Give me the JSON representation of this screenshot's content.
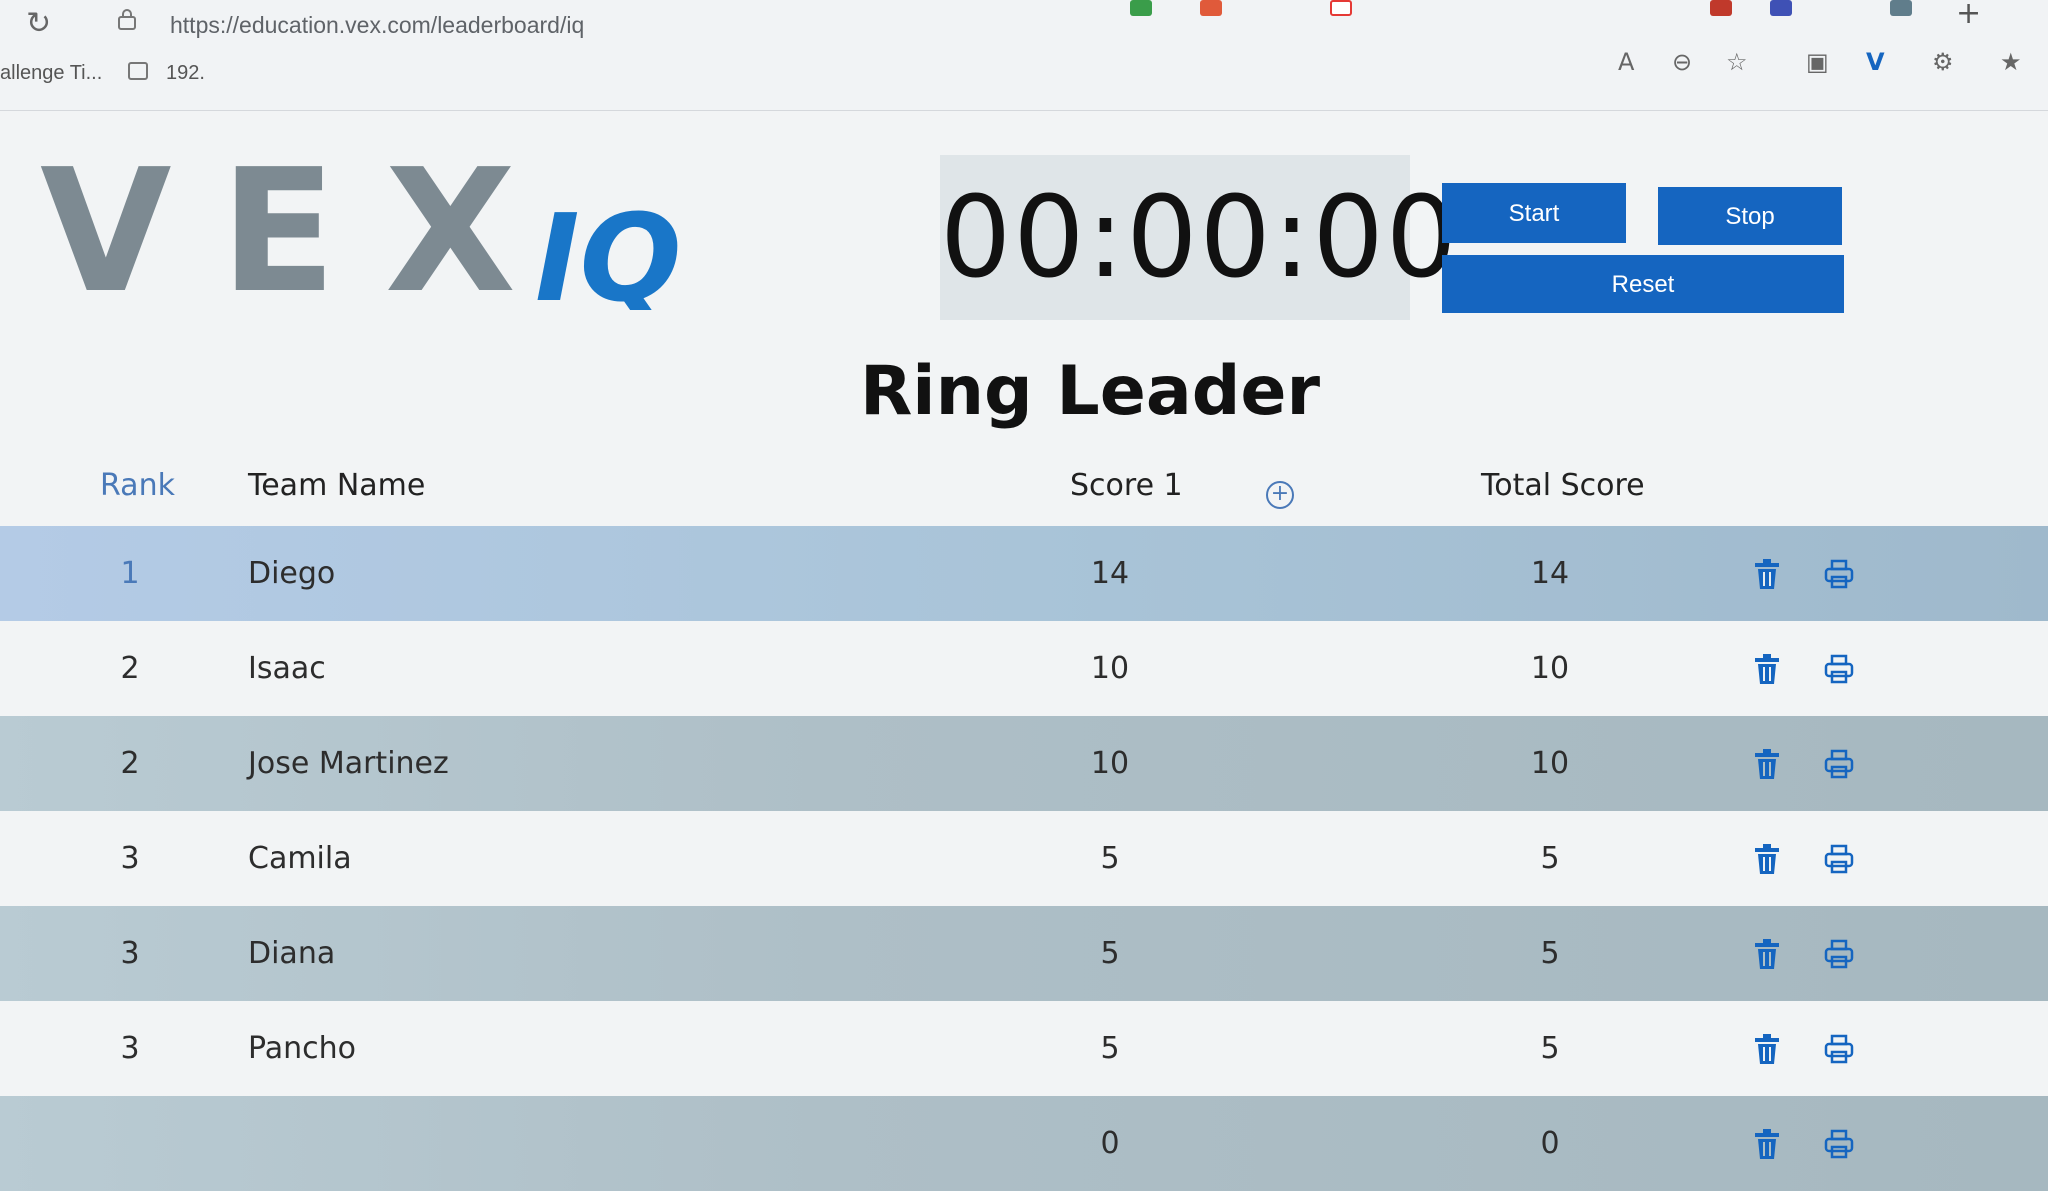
{
  "browser": {
    "url": "https://education.vex.com/leaderboard/iq",
    "bookmarks": [
      "allenge Ti...",
      "192."
    ]
  },
  "logo": {
    "vex": "VEX",
    "iq": "IQ"
  },
  "timer": {
    "display": "00:00:00"
  },
  "controls": {
    "start": "Start",
    "stop": "Stop",
    "reset": "Reset"
  },
  "title": "Ring Leader",
  "table": {
    "headers": {
      "rank": "Rank",
      "team": "Team Name",
      "score1": "Score 1",
      "total": "Total Score"
    },
    "add_column_symbol": "+",
    "rows": [
      {
        "rank": "1",
        "team": "Diego",
        "score1": "14",
        "total": "14"
      },
      {
        "rank": "2",
        "team": "Isaac",
        "score1": "10",
        "total": "10"
      },
      {
        "rank": "2",
        "team": "Jose Martinez",
        "score1": "10",
        "total": "10"
      },
      {
        "rank": "3",
        "team": "Camila",
        "score1": "5",
        "total": "5"
      },
      {
        "rank": "3",
        "team": "Diana",
        "score1": "5",
        "total": "5"
      },
      {
        "rank": "3",
        "team": "Pancho",
        "score1": "5",
        "total": "5"
      },
      {
        "rank": "",
        "team": "",
        "score1": "0",
        "total": "0"
      }
    ]
  },
  "colors": {
    "accent": "#1565c0",
    "rank_blue": "#4a79b8",
    "row_shade": "#aebfc7"
  },
  "icons": {
    "delete": "trash-icon",
    "print": "printer-icon",
    "reload": "reload-icon"
  }
}
